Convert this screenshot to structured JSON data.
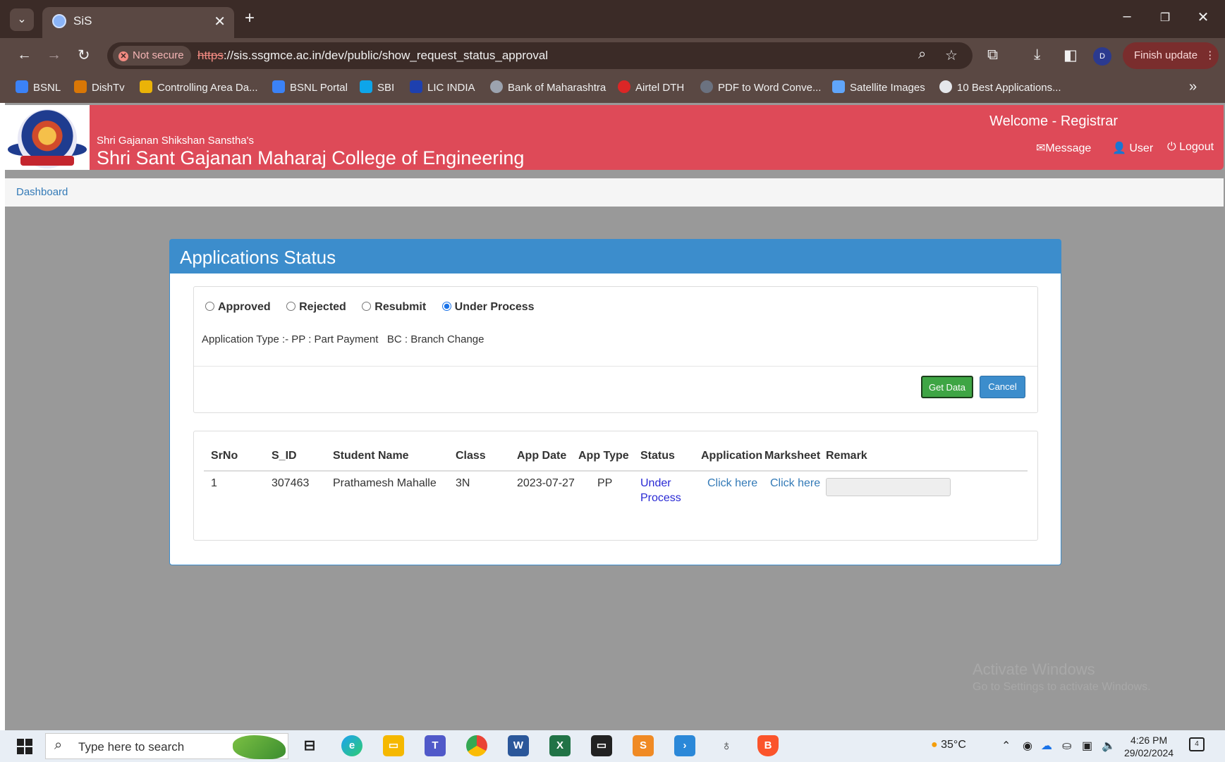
{
  "browser": {
    "tab_title": "SiS",
    "not_secure_label": "Not secure",
    "url_scheme": "https",
    "url_rest": "://sis.ssgmce.ac.in/dev/public/show_request_status_approval",
    "profile_initial": "D",
    "finish_update_label": "Finish update",
    "bookmarks": [
      {
        "label": "BSNL",
        "color": "#3b82f6"
      },
      {
        "label": "DishTv",
        "color": "#d97706"
      },
      {
        "label": "Controlling Area Da...",
        "color": "#eab308"
      },
      {
        "label": "BSNL Portal",
        "color": "#3b82f6"
      },
      {
        "label": "SBI",
        "color": "#0ea5e9"
      },
      {
        "label": "LIC INDIA",
        "color": "#1e40af"
      },
      {
        "label": "Bank of Maharashtra",
        "color": "#9ca3af"
      },
      {
        "label": "Airtel DTH",
        "color": "#dc2626"
      },
      {
        "label": "PDF to Word Conve...",
        "color": "#6b7280"
      },
      {
        "label": "Satellite Images",
        "color": "#60a5fa"
      },
      {
        "label": "10 Best Applications...",
        "color": "#e5e7eb"
      }
    ]
  },
  "header": {
    "org_subtitle": "Shri Gajanan Shikshan Sanstha's",
    "org_title": "Shri Sant Gajanan Maharaj College of Engineering",
    "welcome": "Welcome - Registrar",
    "links": {
      "message": "Message",
      "user": "User",
      "logout": "Logout"
    }
  },
  "breadcrumb": {
    "dashboard": "Dashboard"
  },
  "panel": {
    "title": "Applications Status",
    "radios": [
      {
        "label": "Approved",
        "selected": false
      },
      {
        "label": "Rejected",
        "selected": false
      },
      {
        "label": "Resubmit",
        "selected": false
      },
      {
        "label": "Under Process",
        "selected": true
      }
    ],
    "legend": "Application Type :- PP : Part Payment   BC : Branch Change",
    "get_data_label": "Get Data",
    "cancel_label": "Cancel"
  },
  "table": {
    "columns": [
      "SrNo",
      "S_ID",
      "Student Name",
      "Class",
      "App Date",
      "App Type",
      "Status",
      "Application",
      "Marksheet",
      "Remark"
    ],
    "rows": [
      {
        "srno": "1",
        "s_id": "307463",
        "student_name": "Prathamesh Mahalle",
        "class": "3N",
        "app_date": "2023-07-27",
        "app_type": "PP",
        "status": "Under Process",
        "application": "Click here",
        "marksheet": "Click here",
        "remark": ""
      }
    ]
  },
  "watermark": {
    "line1": "Activate Windows",
    "line2": "Go to Settings to activate Windows."
  },
  "taskbar": {
    "search_placeholder": "Type here to search",
    "temperature": "35°C",
    "time": "4:26 PM",
    "date": "29/02/2024",
    "notification_count": "4"
  }
}
